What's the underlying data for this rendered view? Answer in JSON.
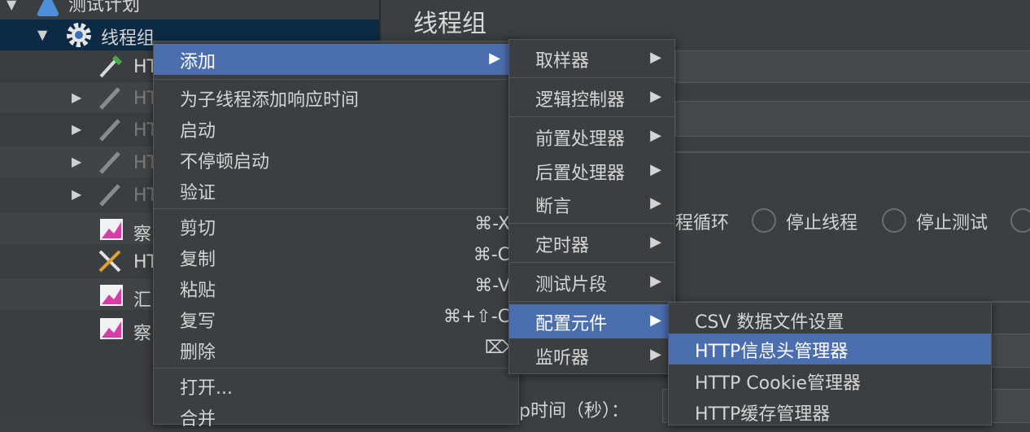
{
  "tree": {
    "root_label": "测试计划",
    "group_label": "线程组",
    "items": [
      {
        "label": "HT"
      },
      {
        "label": "HT"
      },
      {
        "label": "HT"
      },
      {
        "label": "HT"
      },
      {
        "label": "HT"
      },
      {
        "label": "察"
      },
      {
        "label": "HT"
      },
      {
        "label": "汇"
      },
      {
        "label": "察"
      }
    ]
  },
  "panel": {
    "title": "线程组",
    "loop_label": "程循环",
    "stop_thread": "停止线程",
    "stop_test": "停止测试",
    "ramp_label": "p时间（秒）："
  },
  "context_menu": {
    "add": "添加",
    "add_think_time": "为子线程添加响应时间",
    "start": "启动",
    "start_no_pause": "不停顿启动",
    "validate": "验证",
    "cut": "剪切",
    "cut_sc": "⌘-X",
    "copy": "复制",
    "copy_sc": "⌘-C",
    "paste": "粘贴",
    "paste_sc": "⌘-V",
    "duplicate": "复写",
    "duplicate_sc": "⌘+⇧-C",
    "delete": "删除",
    "delete_sc": "⌦",
    "open": "打开...",
    "merge": "合并"
  },
  "add_submenu": {
    "sampler": "取样器",
    "logic_controller": "逻辑控制器",
    "pre_processor": "前置处理器",
    "post_processor": "后置处理器",
    "assertion": "断言",
    "timer": "定时器",
    "test_fragment": "测试片段",
    "config_element": "配置元件",
    "listener": "监听器"
  },
  "config_submenu": {
    "csv": "CSV 数据文件设置",
    "header_manager": "HTTP信息头管理器",
    "cookie_manager": "HTTP Cookie管理器",
    "cache_manager": "HTTP缓存管理器"
  },
  "colors": {
    "highlight": "#4b6eaf",
    "selected_row": "#0d2a44",
    "background": "#3c3f41"
  }
}
